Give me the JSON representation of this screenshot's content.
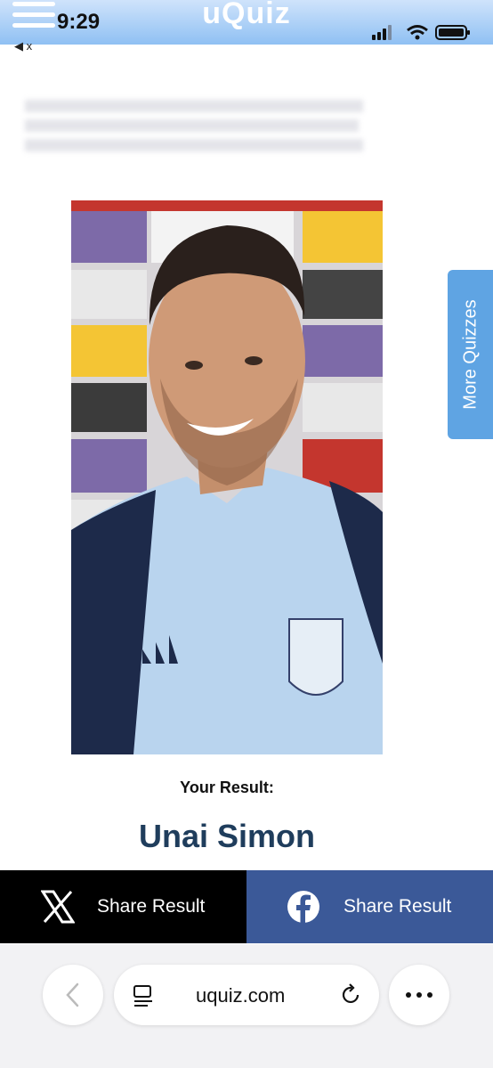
{
  "status_bar": {
    "time": "9:29"
  },
  "header": {
    "logo_text": "uQuiz"
  },
  "adbar": {
    "label": "◀ x"
  },
  "side_tab": {
    "label": "More Quizzes"
  },
  "result": {
    "label": "Your Result:",
    "name": "Unai Simon"
  },
  "share": {
    "x_label": "Share Result",
    "facebook_label": "Share Result"
  },
  "browser": {
    "url": "uquiz.com"
  },
  "colors": {
    "header_start": "#cfe3fb",
    "header_end": "#8fc0f3",
    "side_tab": "#5fa4e3",
    "result_name": "#1f3d5c",
    "share_x_bg": "#000000",
    "share_facebook_bg": "#3b5998"
  }
}
